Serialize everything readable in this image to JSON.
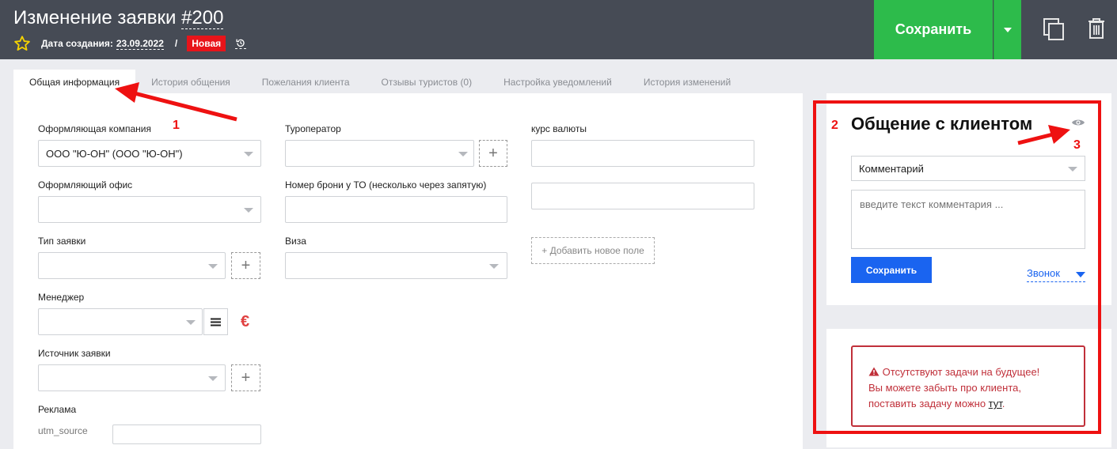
{
  "header": {
    "title_prefix": "Изменение заявки ",
    "title_number": "#200",
    "created_label": "Дата создания:",
    "created_date": "23.09.2022",
    "separator": "/",
    "status_badge": "Новая",
    "save_label": "Сохранить",
    "bg_color": "#464b55",
    "save_color": "#2dbb4b"
  },
  "tabs": [
    {
      "label": "Общая информация",
      "active": true
    },
    {
      "label": "История общения"
    },
    {
      "label": "Пожелания клиента"
    },
    {
      "label": "Отзывы туристов (0)"
    },
    {
      "label": "Настройка уведомлений"
    },
    {
      "label": "История изменений"
    }
  ],
  "form": {
    "company_label": "Оформляющая компания",
    "company_value": "ООО \"Ю-ОН\" (ООО \"Ю-ОН\")",
    "office_label": "Оформляющий офис",
    "type_label": "Тип заявки",
    "manager_label": "Менеджер",
    "currency_symbol": "€",
    "source_label": "Источник заявки",
    "ads_label": "Реклама",
    "utm_label": "utm_source",
    "operator_label": "Туроператор",
    "booking_label": "Номер брони у ТО (несколько через запятую)",
    "visa_label": "Виза",
    "rate_label": "курс валюты",
    "add_field_label": "+ Добавить новое поле"
  },
  "communication": {
    "title": "Общение с клиентом",
    "type_value": "Комментарий",
    "comment_placeholder": "введите текст комментария ...",
    "save_label": "Сохранить",
    "call_label": "Звонок"
  },
  "tasks_alert": {
    "line1": "Отсутствуют задачи на будущее!",
    "line2": "Вы можете забыть про клиента,",
    "line3_prefix": "поставить задачу можно ",
    "line3_link": "тут",
    "line3_suffix": ".",
    "color": "#c0303a"
  },
  "annotations": {
    "n1": "1",
    "n2": "2",
    "n3": "3",
    "color": "#ee1111"
  },
  "icons": [
    "star-icon",
    "history-icon",
    "chevron-down-icon",
    "copy-icon",
    "trash-icon",
    "plus-icon",
    "menu-icon",
    "eye-icon",
    "warning-icon"
  ]
}
